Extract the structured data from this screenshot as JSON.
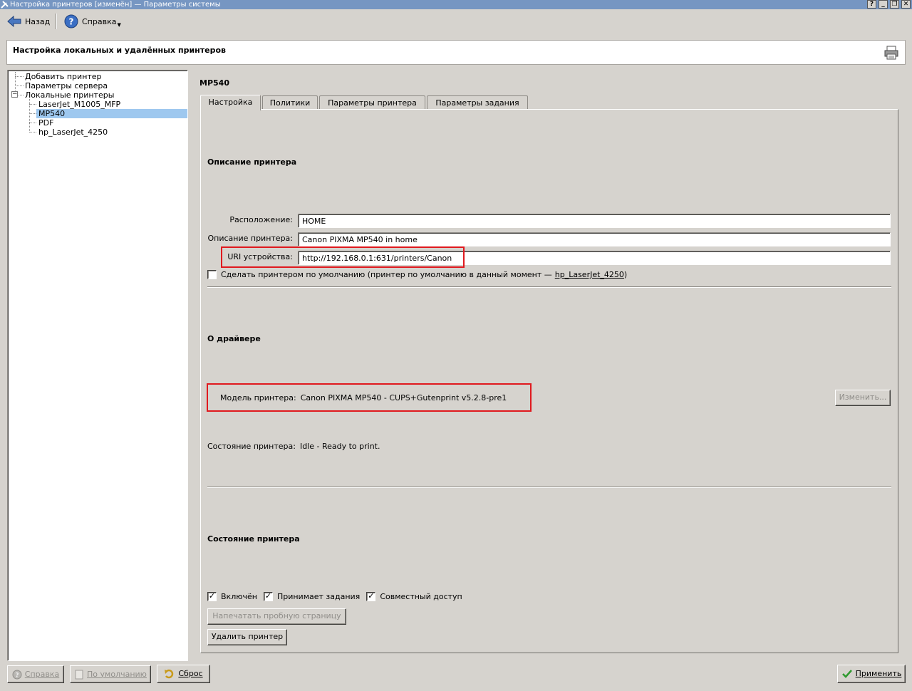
{
  "window": {
    "title": "Настройка принтеров [изменён] — Параметры системы",
    "controls": [
      "?",
      "_",
      "❐",
      "✕"
    ]
  },
  "toolbar": {
    "back_label": "Назад",
    "help_label": "Справка"
  },
  "header": {
    "title": "Настройка локальных и удалённых принтеров"
  },
  "tree": {
    "items": [
      {
        "label": "Добавить принтер"
      },
      {
        "label": "Параметры сервера"
      },
      {
        "label": "Локальные принтеры"
      },
      {
        "label": "LaserJet_M1005_MFP"
      },
      {
        "label": "MP540"
      },
      {
        "label": "PDF"
      },
      {
        "label": "hp_LaserJet_4250"
      }
    ],
    "expander_symbol": "−"
  },
  "printer": {
    "name": "MP540"
  },
  "tabs": [
    {
      "label": "Настройка"
    },
    {
      "label": "Политики"
    },
    {
      "label": "Параметры принтера"
    },
    {
      "label": "Параметры задания"
    }
  ],
  "description": {
    "section_title": "Описание принтера",
    "location_label": "Расположение:",
    "location_value": "HOME",
    "desc_label": "Описание принтера:",
    "desc_value": "Canon PIXMA MP540 in home",
    "uri_label": "URI устройства:",
    "uri_value": "http://192.168.0.1:631/printers/Canon",
    "default_checkbox_text": "Сделать принтером по умолчанию (принтер по умолчанию в данный момент —",
    "default_printer_link": "hp_LaserJet_4250",
    "default_close_paren": ")",
    "default_checked": false
  },
  "driver": {
    "section_title": "О драйвере",
    "model_label": "Модель принтера:",
    "model_value": "Canon PIXMA MP540 - CUPS+Gutenprint v5.2.8-pre1",
    "change_button": "Изменить...",
    "status_label": "Состояние принтера:",
    "status_value": "Idle - Ready to print."
  },
  "state": {
    "section_title": "Состояние принтера",
    "enabled_label": "Включён",
    "enabled_checked": true,
    "accepts_label": "Принимает задания",
    "accepts_checked": true,
    "shared_label": "Совместный доступ",
    "shared_checked": true,
    "test_page_button": "Напечатать пробную страницу",
    "delete_button": "Удалить принтер"
  },
  "footer": {
    "help_button": "Справка",
    "defaults_button": "По умолчанию",
    "reset_button": "Сброс",
    "apply_button": "Применить"
  },
  "colors": {
    "titlebar": "#7696c2",
    "selection": "#9ec8ef",
    "highlight_box": "#e0191e"
  }
}
